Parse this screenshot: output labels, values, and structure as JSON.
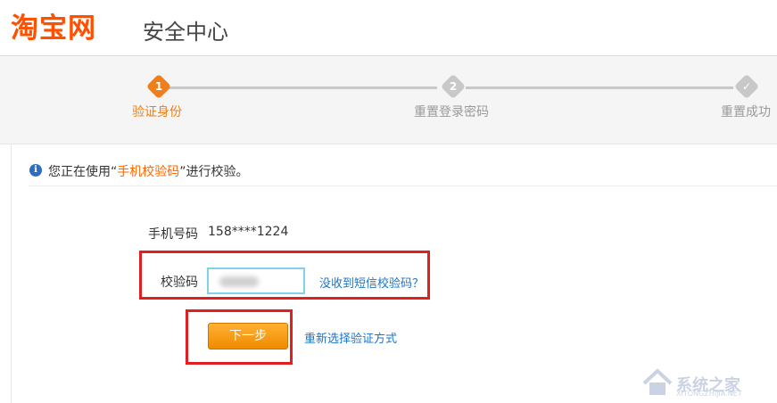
{
  "header": {
    "logo_text": "淘宝网",
    "subtitle": "安全中心"
  },
  "steps": [
    {
      "number": "1",
      "label": "验证身份",
      "state": "active",
      "color": "#ee7f1a"
    },
    {
      "number": "2",
      "label": "重置登录密码",
      "state": "pending",
      "color": "#c8c8c8"
    },
    {
      "number": "✓",
      "label": "重置成功",
      "state": "pending",
      "color": "#c8c8c8"
    }
  ],
  "info": {
    "prefix": "您正在使用“",
    "method": "手机校验码",
    "suffix": "”进行校验。"
  },
  "form": {
    "phone_label": "手机号码",
    "phone_value": "158****1224",
    "code_label": "校验码",
    "code_value": "",
    "no_code_link": "没收到短信校验码？",
    "next_button": "下一步",
    "reselect_link": "重新选择验证方式"
  },
  "watermark": {
    "text": "系统之家",
    "sub": "XITONGZHIJIA.NET"
  },
  "colors": {
    "accent": "#ff5000",
    "step_active": "#ee7f1a",
    "link": "#1a75c9",
    "highlight_box": "#e02020"
  }
}
